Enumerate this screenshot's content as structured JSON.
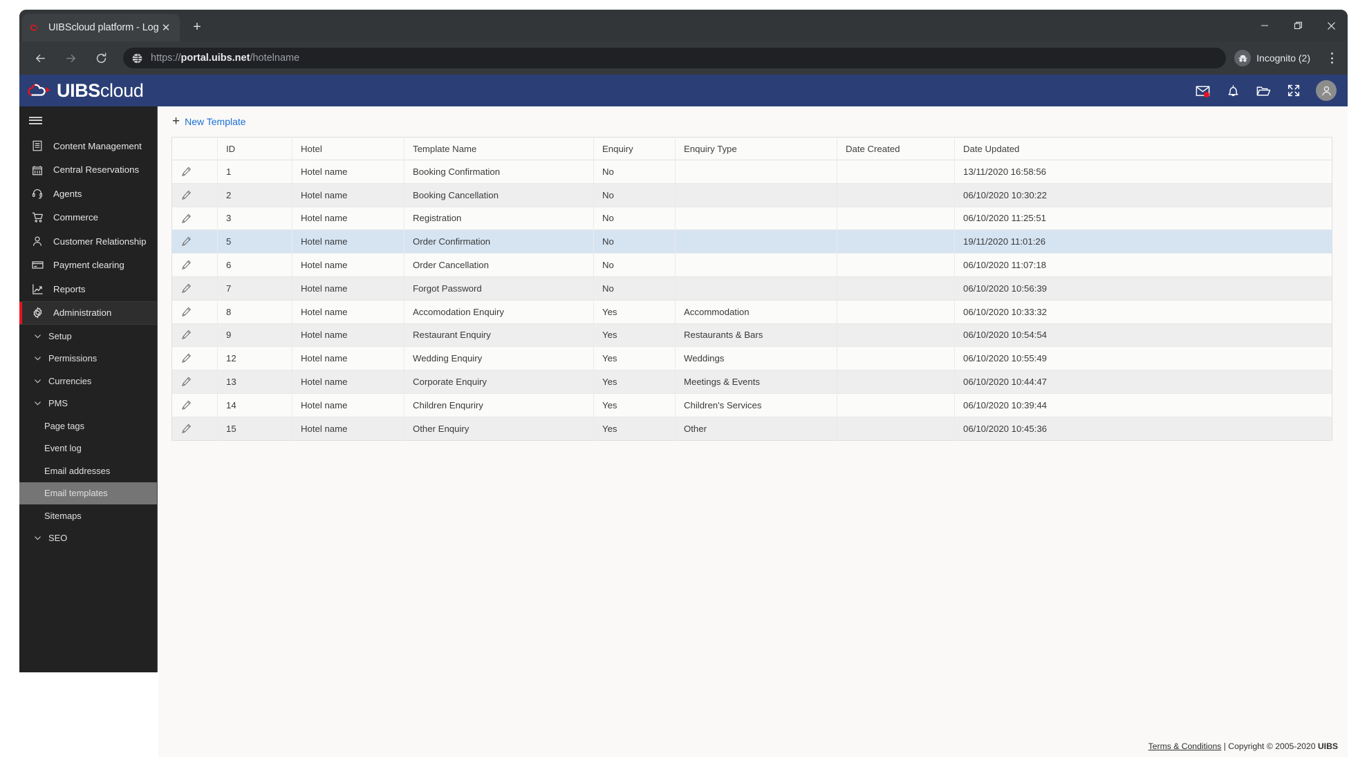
{
  "browser": {
    "tab": {
      "title": "UIBScloud platform - Login",
      "favicon": "uibs-logo-icon",
      "close_label": "✕"
    },
    "new_tab_label": "+",
    "window_controls": {
      "minimize": "minimize-icon",
      "maximize": "maximize-icon",
      "close": "close-icon"
    },
    "nav": {
      "back": "back-arrow-icon",
      "forward": "forward-arrow-icon",
      "reload": "reload-icon"
    },
    "address": {
      "scheme": "https://",
      "host": "portal.uibs.net",
      "path": "/hotelname",
      "full": "https://portal.uibs.net/hotelname",
      "site_icon": "globe-icon"
    },
    "profile": {
      "label": "Incognito (2)",
      "icon": "incognito-icon"
    },
    "menu": "kebab-menu-icon"
  },
  "appbar": {
    "logo": {
      "brand_bold": "UIBS",
      "brand_thin": "cloud",
      "mark": "cloud-logo-icon"
    },
    "brand_color": "#2b3f76",
    "accent_color": "#e8131d",
    "actions": [
      {
        "name": "messages-icon",
        "label": "Messages",
        "badge": true
      },
      {
        "name": "notifications-icon",
        "label": "Notifications",
        "badge": false
      },
      {
        "name": "folder-icon",
        "label": "Files",
        "badge": false
      },
      {
        "name": "fullscreen-icon",
        "label": "Fullscreen",
        "badge": false
      }
    ],
    "avatar": {
      "name": "user-avatar",
      "label": "Account"
    }
  },
  "sidebar": {
    "toggle_label": "Menu",
    "items": [
      {
        "label": "Content Management",
        "icon": "document-icon",
        "active": false
      },
      {
        "label": "Central Reservations",
        "icon": "calendar-icon",
        "active": false
      },
      {
        "label": "Agents",
        "icon": "headset-icon",
        "active": false
      },
      {
        "label": "Commerce",
        "icon": "cart-icon",
        "active": false
      },
      {
        "label": "Customer Relationship",
        "icon": "person-icon",
        "active": false
      },
      {
        "label": "Payment clearing",
        "icon": "credit-card-icon",
        "active": false
      },
      {
        "label": "Reports",
        "icon": "chart-line-icon",
        "active": false
      },
      {
        "label": "Administration",
        "icon": "gear-icon",
        "active": true
      }
    ],
    "subitems": [
      {
        "label": "Setup",
        "chevron": true,
        "selected": false
      },
      {
        "label": "Permissions",
        "chevron": true,
        "selected": false
      },
      {
        "label": "Currencies",
        "chevron": true,
        "selected": false
      },
      {
        "label": "PMS",
        "chevron": true,
        "selected": false
      },
      {
        "label": "Page tags",
        "chevron": false,
        "selected": false
      },
      {
        "label": "Event log",
        "chevron": false,
        "selected": false
      },
      {
        "label": "Email addresses",
        "chevron": false,
        "selected": false
      },
      {
        "label": "Email templates",
        "chevron": false,
        "selected": true
      },
      {
        "label": "Sitemaps",
        "chevron": false,
        "selected": false
      },
      {
        "label": "SEO",
        "chevron": true,
        "selected": false
      }
    ]
  },
  "main": {
    "new_template_label": "New Template",
    "new_template_icon": "plus-icon",
    "table": {
      "columns": [
        "",
        "ID",
        "Hotel",
        "Template Name",
        "Enquiry",
        "Enquiry Type",
        "Date Created",
        "Date Updated"
      ],
      "row_action_icon": "edit-pencil-icon",
      "rows": [
        {
          "id": "1",
          "hotel": "Hotel name",
          "template": "Booking Confirmation",
          "enquiry": "No",
          "type": "",
          "created": "",
          "updated": "13/11/2020 16:58:56",
          "selected": false
        },
        {
          "id": "2",
          "hotel": "Hotel name",
          "template": "Booking Cancellation",
          "enquiry": "No",
          "type": "",
          "created": "",
          "updated": "06/10/2020 10:30:22",
          "selected": false
        },
        {
          "id": "3",
          "hotel": "Hotel name",
          "template": "Registration",
          "enquiry": "No",
          "type": "",
          "created": "",
          "updated": "06/10/2020 11:25:51",
          "selected": false
        },
        {
          "id": "5",
          "hotel": "Hotel name",
          "template": "Order Confirmation",
          "enquiry": "No",
          "type": "",
          "created": "",
          "updated": "19/11/2020 11:01:26",
          "selected": true
        },
        {
          "id": "6",
          "hotel": "Hotel name",
          "template": "Order Cancellation",
          "enquiry": "No",
          "type": "",
          "created": "",
          "updated": "06/10/2020 11:07:18",
          "selected": false
        },
        {
          "id": "7",
          "hotel": "Hotel name",
          "template": "Forgot Password",
          "enquiry": "No",
          "type": "",
          "created": "",
          "updated": "06/10/2020 10:56:39",
          "selected": false
        },
        {
          "id": "8",
          "hotel": "Hotel name",
          "template": "Accomodation Enquiry",
          "enquiry": "Yes",
          "type": "Accommodation",
          "created": "",
          "updated": "06/10/2020 10:33:32",
          "selected": false
        },
        {
          "id": "9",
          "hotel": "Hotel name",
          "template": "Restaurant Enquiry",
          "enquiry": "Yes",
          "type": "Restaurants & Bars",
          "created": "",
          "updated": "06/10/2020 10:54:54",
          "selected": false
        },
        {
          "id": "12",
          "hotel": "Hotel name",
          "template": "Wedding Enquiry",
          "enquiry": "Yes",
          "type": "Weddings",
          "created": "",
          "updated": "06/10/2020 10:55:49",
          "selected": false
        },
        {
          "id": "13",
          "hotel": "Hotel name",
          "template": "Corporate Enquiry",
          "enquiry": "Yes",
          "type": "Meetings & Events",
          "created": "",
          "updated": "06/10/2020 10:44:47",
          "selected": false
        },
        {
          "id": "14",
          "hotel": "Hotel name",
          "template": "Children Enquriry",
          "enquiry": "Yes",
          "type": "Children's Services",
          "created": "",
          "updated": "06/10/2020 10:39:44",
          "selected": false
        },
        {
          "id": "15",
          "hotel": "Hotel name",
          "template": "Other Enquiry",
          "enquiry": "Yes",
          "type": "Other",
          "created": "",
          "updated": "06/10/2020 10:45:36",
          "selected": false
        }
      ]
    },
    "selected_row_color": "#d6e4f2"
  },
  "footer": {
    "terms_label": "Terms & Conditions",
    "separator": " | ",
    "copyright": "Copyright © 2005-2020 ",
    "company": "UIBS"
  }
}
